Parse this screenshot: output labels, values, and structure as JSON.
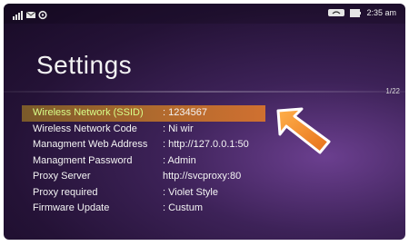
{
  "status_bar": {
    "time": "2:35 am",
    "left_icons": [
      "signal-icon",
      "message-icon",
      "settings-icon"
    ],
    "right_icons": [
      "wifi-icon",
      "battery-icon"
    ]
  },
  "screen": {
    "title": "Settings",
    "page_indicator": "1/22"
  },
  "settings": [
    {
      "label": "Wireless Network (SSID)",
      "value": ": 1234567",
      "selected": true
    },
    {
      "label": "Wireless Network Code",
      "value": ": Ni wir"
    },
    {
      "label": "Managment Web Address",
      "value": ": http://127.0.0.1:50"
    },
    {
      "label": "Managment Password",
      "value": ": Admin"
    },
    {
      "label": "Proxy Server",
      "value": "http://svcproxy:80"
    },
    {
      "label": "Proxy required",
      "value": ": Violet Style"
    },
    {
      "label": "Firmware Update",
      "value": ": Custum"
    }
  ],
  "colors": {
    "accent_highlight": "#d07030",
    "selected_label": "#d8ff8a",
    "arrow": "#f08a1e"
  }
}
